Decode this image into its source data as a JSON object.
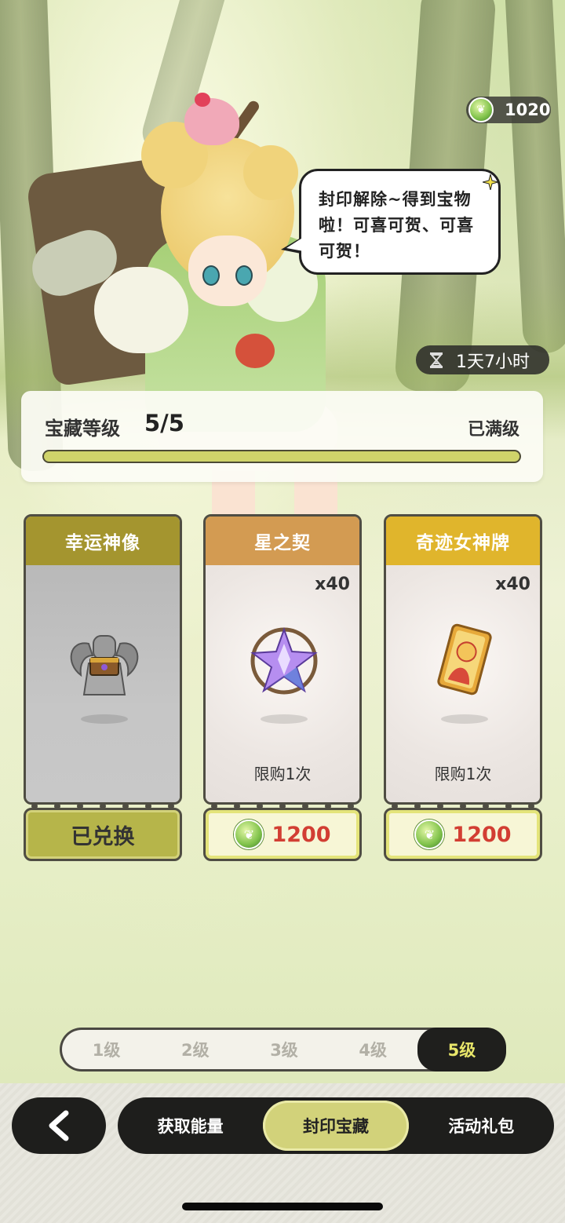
{
  "hud": {
    "currency_icon": "energy-leaf-icon",
    "currency_value": "1020",
    "timer_icon": "hourglass-icon",
    "timer_text": "1天7小时"
  },
  "speech": {
    "text": "封印解除~得到宝物啦！可喜可贺、可喜可贺！"
  },
  "treasure_level": {
    "title": "宝藏等级",
    "value": "5/5",
    "status": "已满级",
    "progress": 1.0
  },
  "cards": [
    {
      "name": "幸运神像",
      "icon": "winged-statue-chest-icon",
      "quantity": "",
      "limit": "",
      "button_label": "已兑换",
      "price": ""
    },
    {
      "name": "星之契",
      "icon": "star-crystal-icon",
      "quantity": "x40",
      "limit": "限购1次",
      "button_label": "",
      "price": "1200"
    },
    {
      "name": "奇迹女神牌",
      "icon": "goddess-card-icon",
      "quantity": "x40",
      "limit": "限购1次",
      "button_label": "",
      "price": "1200"
    }
  ],
  "level_tabs": [
    {
      "label": "1级",
      "active": false
    },
    {
      "label": "2级",
      "active": false
    },
    {
      "label": "3级",
      "active": false
    },
    {
      "label": "4级",
      "active": false
    },
    {
      "label": "5级",
      "active": true
    }
  ],
  "bottom_nav": {
    "back_icon": "chevron-left-icon",
    "tabs": [
      {
        "label": "获取能量",
        "active": false
      },
      {
        "label": "封印宝藏",
        "active": true
      },
      {
        "label": "活动礼包",
        "active": false
      }
    ]
  },
  "colors": {
    "accent": "#d2d27a",
    "price": "#d23e33",
    "dark": "#1e1e1c"
  }
}
